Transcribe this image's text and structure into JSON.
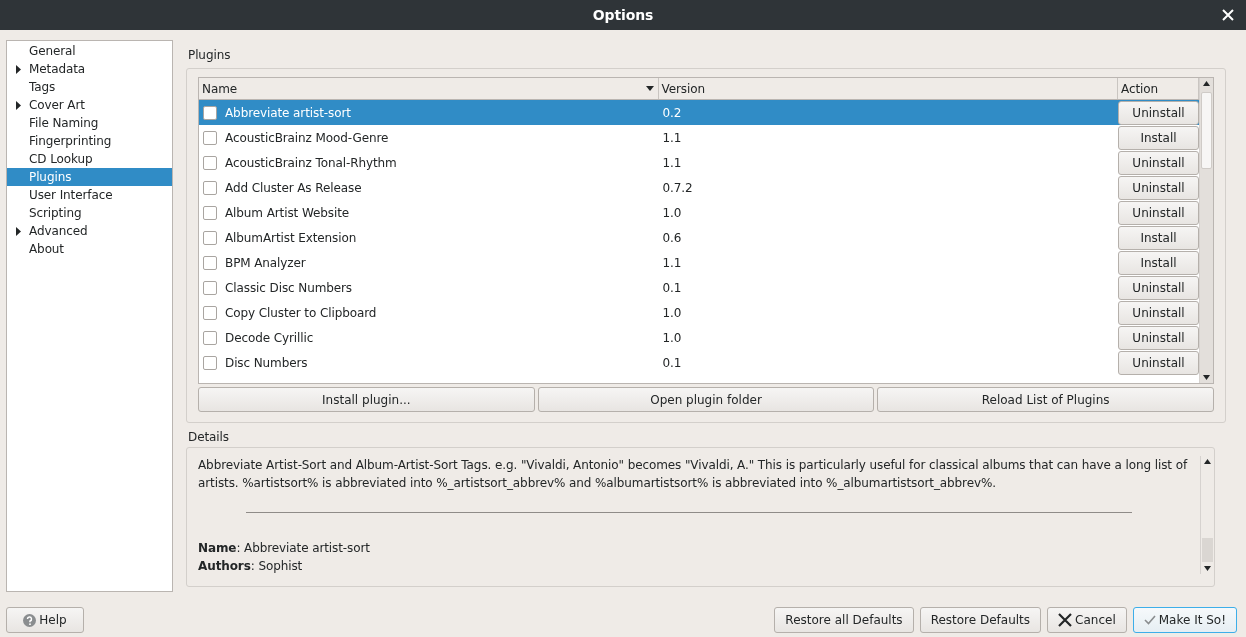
{
  "window": {
    "title": "Options"
  },
  "sidebar": {
    "items": [
      {
        "label": "General",
        "expander": false,
        "selected": false
      },
      {
        "label": "Metadata",
        "expander": true,
        "selected": false
      },
      {
        "label": "Tags",
        "expander": false,
        "selected": false
      },
      {
        "label": "Cover Art",
        "expander": true,
        "selected": false
      },
      {
        "label": "File Naming",
        "expander": false,
        "selected": false
      },
      {
        "label": "Fingerprinting",
        "expander": false,
        "selected": false
      },
      {
        "label": "CD Lookup",
        "expander": false,
        "selected": false
      },
      {
        "label": "Plugins",
        "expander": false,
        "selected": true
      },
      {
        "label": "User Interface",
        "expander": false,
        "selected": false
      },
      {
        "label": "Scripting",
        "expander": false,
        "selected": false
      },
      {
        "label": "Advanced",
        "expander": true,
        "selected": false
      },
      {
        "label": "About",
        "expander": false,
        "selected": false
      }
    ]
  },
  "plugins": {
    "label": "Plugins",
    "columns": [
      {
        "label": "Name",
        "sorted": true
      },
      {
        "label": "Version",
        "sorted": false
      },
      {
        "label": "Action",
        "sorted": false
      }
    ],
    "rows": [
      {
        "name": "Abbreviate artist-sort",
        "version": "0.2",
        "action": "Uninstall",
        "checked": false,
        "selected": true
      },
      {
        "name": "AcousticBrainz Mood-Genre",
        "version": "1.1",
        "action": "Install",
        "checked": false,
        "selected": false
      },
      {
        "name": "AcousticBrainz Tonal-Rhythm",
        "version": "1.1",
        "action": "Uninstall",
        "checked": false,
        "selected": false
      },
      {
        "name": "Add Cluster As Release",
        "version": "0.7.2",
        "action": "Uninstall",
        "checked": false,
        "selected": false
      },
      {
        "name": "Album Artist Website",
        "version": "1.0",
        "action": "Uninstall",
        "checked": false,
        "selected": false
      },
      {
        "name": "AlbumArtist Extension",
        "version": "0.6",
        "action": "Install",
        "checked": false,
        "selected": false
      },
      {
        "name": "BPM Analyzer",
        "version": "1.1",
        "action": "Install",
        "checked": false,
        "selected": false
      },
      {
        "name": "Classic Disc Numbers",
        "version": "0.1",
        "action": "Uninstall",
        "checked": false,
        "selected": false
      },
      {
        "name": "Copy Cluster to Clipboard",
        "version": "1.0",
        "action": "Uninstall",
        "checked": false,
        "selected": false
      },
      {
        "name": "Decode Cyrillic",
        "version": "1.0",
        "action": "Uninstall",
        "checked": false,
        "selected": false
      },
      {
        "name": "Disc Numbers",
        "version": "0.1",
        "action": "Uninstall",
        "checked": false,
        "selected": false
      }
    ],
    "buttons": [
      "Install plugin...",
      "Open plugin folder",
      "Reload List of Plugins"
    ]
  },
  "details": {
    "label": "Details",
    "description": "Abbreviate Artist-Sort and Album-Artist-Sort Tags. e.g. \"Vivaldi, Antonio\" becomes \"Vivaldi, A.\" This is particularly useful for classical albums that can have a long list of artists. %artistsort% is abbreviated into %_artistsort_abbrev% and %albumartistsort% is abbreviated into %_albumartistsort_abbrev%.",
    "lines": [
      "**Name**: Abbreviate artist-sort",
      "**Authors**: Sophist"
    ]
  },
  "buttons": [
    {
      "label": "Help",
      "kind": "help"
    },
    {
      "label": "Restore all Defaults",
      "kind": "plain"
    },
    {
      "label": "Restore Defaults",
      "kind": "plain"
    },
    {
      "label": "Cancel",
      "kind": "cancel"
    },
    {
      "label": "Make It So!",
      "kind": "ok"
    }
  ]
}
